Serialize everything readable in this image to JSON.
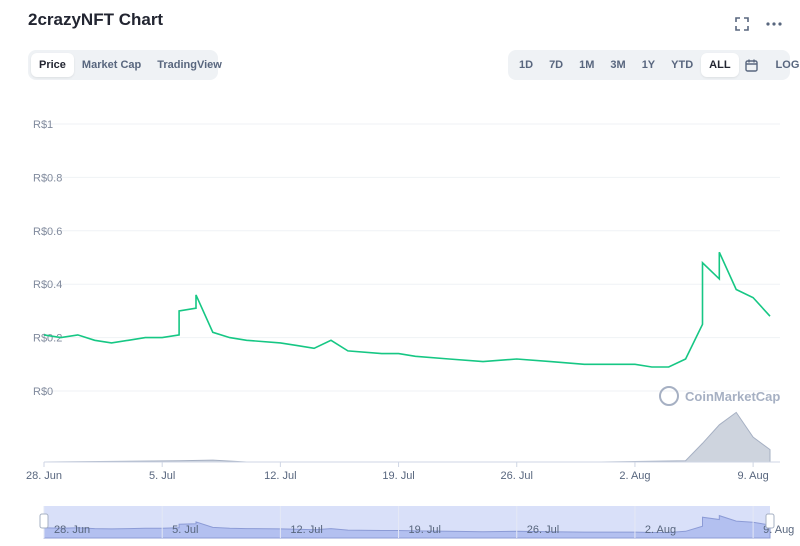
{
  "header": {
    "title": "2crazyNFT Chart"
  },
  "icons": {
    "fullscreen": "fullscreen-icon",
    "more": "more-horizontal-icon",
    "calendar": "calendar-icon"
  },
  "view_tabs": [
    {
      "label": "Price",
      "active": true
    },
    {
      "label": "Market Cap",
      "active": false
    },
    {
      "label": "TradingView",
      "active": false
    }
  ],
  "range_tabs": [
    {
      "label": "1D",
      "active": false
    },
    {
      "label": "7D",
      "active": false
    },
    {
      "label": "1M",
      "active": false
    },
    {
      "label": "3M",
      "active": false
    },
    {
      "label": "1Y",
      "active": false
    },
    {
      "label": "YTD",
      "active": false
    },
    {
      "label": "ALL",
      "active": true
    }
  ],
  "log_label": "LOG",
  "watermark": "CoinMarketCap",
  "colors": {
    "line": "#16c784",
    "volume": "#a6b0c3",
    "navigator_fill": "#c9d3f7",
    "navigator_line": "#8c9bd6",
    "grid": "#eff2f5"
  },
  "chart_data": {
    "type": "line",
    "title": "2crazyNFT Chart",
    "currency": "R$",
    "ylim": [
      0,
      1
    ],
    "y_ticks": [
      {
        "value": 0,
        "label": "R$0"
      },
      {
        "value": 0.2,
        "label": "R$0.2"
      },
      {
        "value": 0.4,
        "label": "R$0.4"
      },
      {
        "value": 0.6,
        "label": "R$0.6"
      },
      {
        "value": 0.8,
        "label": "R$0.8"
      },
      {
        "value": 1,
        "label": "R$1"
      }
    ],
    "x_range": [
      "2021-06-28",
      "2021-08-10"
    ],
    "x_ticks": [
      {
        "date": "2021-06-28",
        "label": "28. Jun"
      },
      {
        "date": "2021-07-05",
        "label": "5. Jul"
      },
      {
        "date": "2021-07-12",
        "label": "12. Jul"
      },
      {
        "date": "2021-07-19",
        "label": "19. Jul"
      },
      {
        "date": "2021-07-26",
        "label": "26. Jul"
      },
      {
        "date": "2021-08-02",
        "label": "2. Aug"
      },
      {
        "date": "2021-08-09",
        "label": "9. Aug"
      }
    ],
    "grid": true,
    "series": [
      {
        "values": [
          {
            "x": "2021-06-28",
            "y": 0.21
          },
          {
            "x": "2021-06-29",
            "y": 0.2
          },
          {
            "x": "2021-06-30",
            "y": 0.21
          },
          {
            "x": "2021-07-01",
            "y": 0.19
          },
          {
            "x": "2021-07-02",
            "y": 0.18
          },
          {
            "x": "2021-07-03",
            "y": 0.19
          },
          {
            "x": "2021-07-04",
            "y": 0.2
          },
          {
            "x": "2021-07-05",
            "y": 0.2
          },
          {
            "x": "2021-07-06",
            "y": 0.21
          },
          {
            "x": "2021-07-06",
            "y": 0.3
          },
          {
            "x": "2021-07-07",
            "y": 0.31
          },
          {
            "x": "2021-07-07",
            "y": 0.36
          },
          {
            "x": "2021-07-08",
            "y": 0.22
          },
          {
            "x": "2021-07-09",
            "y": 0.2
          },
          {
            "x": "2021-07-10",
            "y": 0.19
          },
          {
            "x": "2021-07-12",
            "y": 0.18
          },
          {
            "x": "2021-07-13",
            "y": 0.17
          },
          {
            "x": "2021-07-14",
            "y": 0.16
          },
          {
            "x": "2021-07-15",
            "y": 0.19
          },
          {
            "x": "2021-07-16",
            "y": 0.15
          },
          {
            "x": "2021-07-18",
            "y": 0.14
          },
          {
            "x": "2021-07-19",
            "y": 0.14
          },
          {
            "x": "2021-07-20",
            "y": 0.13
          },
          {
            "x": "2021-07-22",
            "y": 0.12
          },
          {
            "x": "2021-07-24",
            "y": 0.11
          },
          {
            "x": "2021-07-26",
            "y": 0.12
          },
          {
            "x": "2021-07-28",
            "y": 0.11
          },
          {
            "x": "2021-07-30",
            "y": 0.1
          },
          {
            "x": "2021-08-02",
            "y": 0.1
          },
          {
            "x": "2021-08-03",
            "y": 0.09
          },
          {
            "x": "2021-08-04",
            "y": 0.09
          },
          {
            "x": "2021-08-05",
            "y": 0.12
          },
          {
            "x": "2021-08-06",
            "y": 0.25
          },
          {
            "x": "2021-08-06",
            "y": 0.48
          },
          {
            "x": "2021-08-07",
            "y": 0.42
          },
          {
            "x": "2021-08-07",
            "y": 0.52
          },
          {
            "x": "2021-08-08",
            "y": 0.38
          },
          {
            "x": "2021-08-09",
            "y": 0.35
          },
          {
            "x": "2021-08-10",
            "y": 0.28
          }
        ]
      }
    ],
    "volume": {
      "type": "area",
      "values": [
        {
          "x": "2021-06-28",
          "y": 0
        },
        {
          "x": "2021-07-06",
          "y": 0.02
        },
        {
          "x": "2021-07-08",
          "y": 0.03
        },
        {
          "x": "2021-07-10",
          "y": 0
        },
        {
          "x": "2021-07-31",
          "y": 0
        },
        {
          "x": "2021-08-05",
          "y": 0.02
        },
        {
          "x": "2021-08-06",
          "y": 0.3
        },
        {
          "x": "2021-08-07",
          "y": 0.6
        },
        {
          "x": "2021-08-08",
          "y": 0.8
        },
        {
          "x": "2021-08-09",
          "y": 0.4
        },
        {
          "x": "2021-08-10",
          "y": 0.2
        }
      ]
    }
  }
}
